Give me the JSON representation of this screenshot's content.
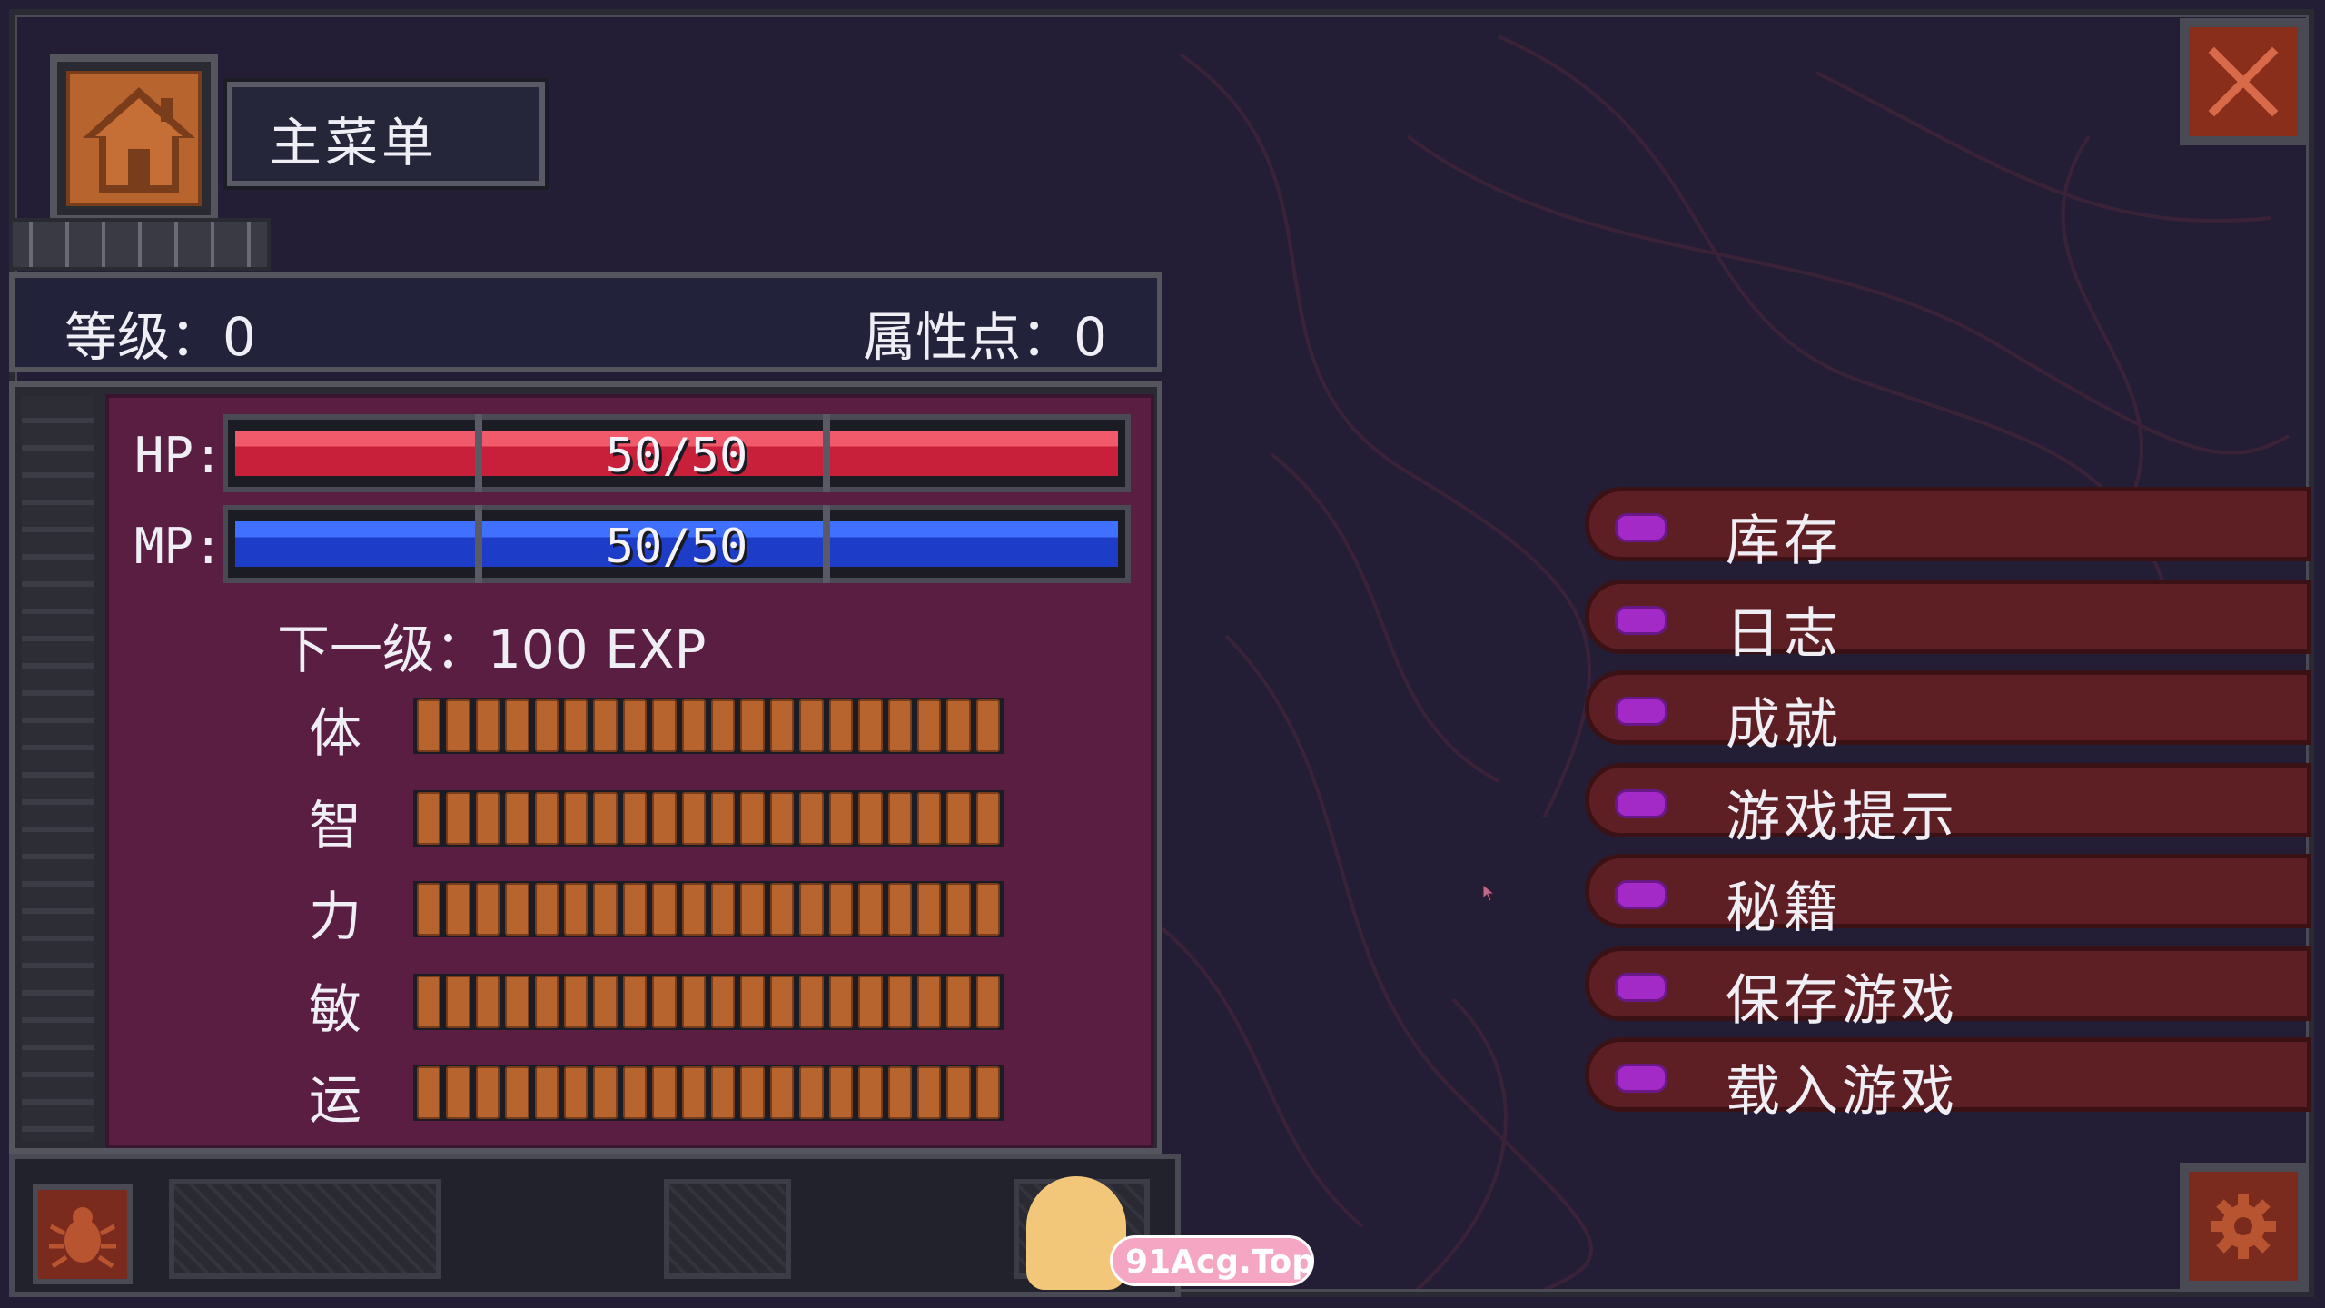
{
  "header": {
    "title": "主菜单"
  },
  "level": {
    "label": "等级：0",
    "attr_points": "属性点：0"
  },
  "bars": {
    "hp": {
      "label": "HP:",
      "value": "50/50",
      "fraction": 1.0,
      "color": "#d02a45"
    },
    "mp": {
      "label": "MP:",
      "value": "50/50",
      "fraction": 1.0,
      "color": "#2a4fd8"
    }
  },
  "next_level": "下一级：100 EXP",
  "stats": [
    {
      "name": "体",
      "pips": 20
    },
    {
      "name": "智",
      "pips": 20
    },
    {
      "name": "力",
      "pips": 20
    },
    {
      "name": "敏",
      "pips": 20
    },
    {
      "name": "运",
      "pips": 20
    }
  ],
  "menu": [
    {
      "label": "库存"
    },
    {
      "label": "日志"
    },
    {
      "label": "成就"
    },
    {
      "label": "游戏提示"
    },
    {
      "label": "秘籍"
    },
    {
      "label": "保存游戏"
    },
    {
      "label": "载入游戏"
    }
  ],
  "icons": {
    "home": "home-icon",
    "close": "close-icon",
    "settings": "gear-icon",
    "bug": "bug-icon"
  },
  "watermark": {
    "text": "91Acg.Top"
  },
  "colors": {
    "accent_orange": "#b8642f",
    "menu_bg": "#5e1f24",
    "menu_dot": "#a42ac8"
  }
}
